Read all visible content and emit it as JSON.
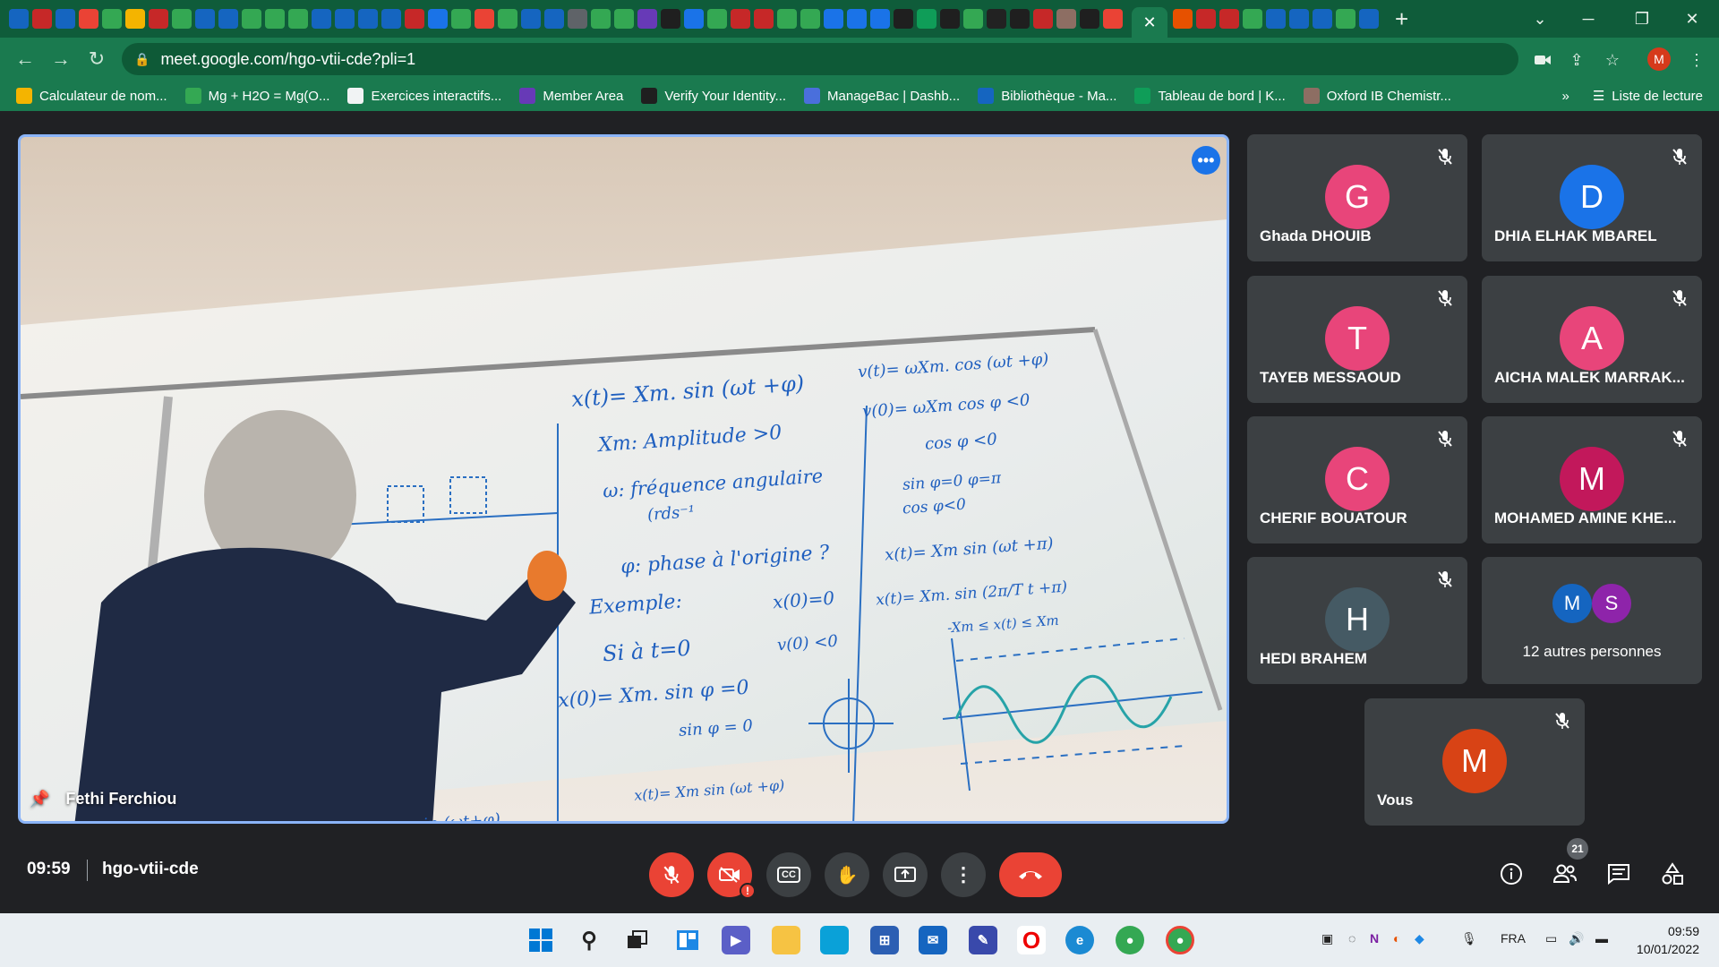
{
  "browser": {
    "url": "meet.google.com/hgo-vtii-cde?pli=1",
    "profile_initial": "M",
    "close_tab": "✕",
    "new_tab": "+"
  },
  "bookmarks": [
    {
      "label": "Calculateur de nom...",
      "color": "#f4b400"
    },
    {
      "label": "Mg + H2O = Mg(O...",
      "color": "#34a853"
    },
    {
      "label": "Exercices interactifs...",
      "color": "#f1f3f4"
    },
    {
      "label": "Member Area",
      "color": "#673ab7"
    },
    {
      "label": "Verify Your Identity...",
      "color": "#1f1f1f"
    },
    {
      "label": "ManageBac | Dashb...",
      "color": "#4a6fdc"
    },
    {
      "label": "Bibliothèque - Ma...",
      "color": "#1565c0"
    },
    {
      "label": "Tableau de bord | K...",
      "color": "#0f9d58"
    },
    {
      "label": "Oxford IB Chemistr...",
      "color": "#8d6e63"
    }
  ],
  "bookmarks_more": "»",
  "reading_list": "Liste de lecture",
  "main_video": {
    "speaker_name": "Fethi Ferchiou",
    "board_lines": [
      "x(t)= Xm. sin (ωt +φ)",
      "Xm: Amplitude >0",
      "ω: fréquence angulaire",
      "(rds⁻¹",
      "φ: phase à l'origine ?",
      "Exemple:",
      "Si à t=0",
      "x(0)=0",
      "v(0) <0",
      "x(0)= Xm. sin φ =0",
      "sin φ = 0",
      "v(t)= ωXm. cos (ωt +φ)",
      "v(0)= ωXm cos φ <0",
      "cos φ <0",
      "sin φ=0   φ=π",
      "cos φ<0",
      "x(t)= Xm sin (ωt +π)",
      "x(t)= Xm. sin (2π/T t +π)",
      "-Xm ≤ x(t) ≤ Xm",
      "x(t)= Xm sin (ωt +φ)",
      "sin (ωt+φ)"
    ]
  },
  "participants": [
    {
      "initial": "G",
      "name": "Ghada DHOUIB",
      "color": "#e8457a"
    },
    {
      "initial": "D",
      "name": "DHIA ELHAK MBAREL",
      "color": "#1a73e8"
    },
    {
      "initial": "T",
      "name": "TAYEB MESSAOUD",
      "color": "#e8457a"
    },
    {
      "initial": "A",
      "name": "AICHA MALEK MARRAK...",
      "color": "#e8457a"
    },
    {
      "initial": "C",
      "name": "CHERIF BOUATOUR",
      "color": "#e8457a"
    },
    {
      "initial": "M",
      "name": "MOHAMED AMINE KHE...",
      "color": "#c2185b"
    },
    {
      "initial": "H",
      "name": "HEDI BRAHEM",
      "color": "#455a64"
    }
  ],
  "others": {
    "initials": [
      "M",
      "S"
    ],
    "colors": [
      "#1565c0",
      "#8e24aa"
    ],
    "label": "12 autres personnes"
  },
  "self_tile": {
    "initial": "M",
    "name": "Vous",
    "color": "#d84315"
  },
  "meeting": {
    "time": "09:59",
    "code": "hgo-vtii-cde",
    "participant_count": "21"
  },
  "taskbar": {
    "language": "FRA",
    "time": "09:59",
    "date": "10/01/2022"
  }
}
